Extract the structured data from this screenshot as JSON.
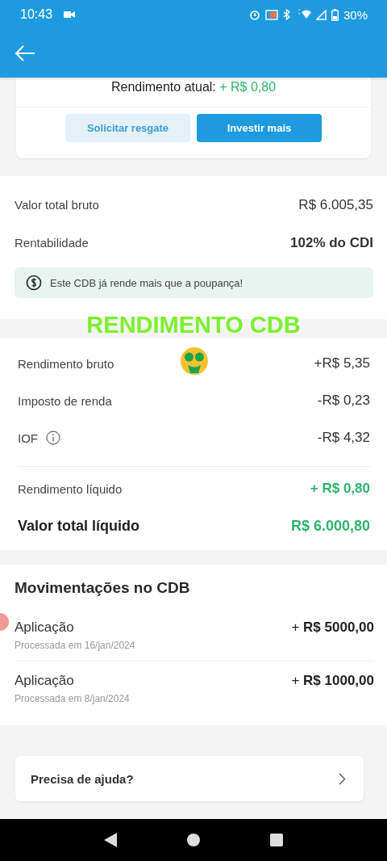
{
  "status_bar": {
    "time": "10:43",
    "battery": "30%"
  },
  "summary_card": {
    "current_yield_label": "Rendimento atual:",
    "current_yield_value": "+ R$ 0,80",
    "buttons": [
      {
        "label": "Solicitar resgate",
        "kind": "secondary"
      },
      {
        "label": "Investir mais",
        "kind": "primary"
      }
    ]
  },
  "totals": {
    "rows": [
      {
        "label": "Valor total bruto",
        "value": "R$ 6.005,35",
        "bold": false
      },
      {
        "label": "Rentabilidade",
        "value": "102% do CDI",
        "bold": true
      }
    ],
    "banner": "Este CDB já rende mais que a poupança!"
  },
  "overlay_caption": "RENDIMENTO CDB",
  "yield_breakdown": {
    "rows": [
      {
        "label": "Rendimento bruto",
        "value": "+R$ 5,35",
        "info": false
      },
      {
        "label": "Imposto de renda",
        "value": "-R$ 0,23",
        "info": false
      },
      {
        "label": "IOF",
        "value": "-R$ 4,32",
        "info": true
      }
    ],
    "net_yield": {
      "label": "Rendimento líquido",
      "value": "+ R$ 0,80"
    },
    "net_total": {
      "label": "Valor total líquido",
      "value": "R$ 6.000,80"
    }
  },
  "movements": {
    "title": "Movimentações no CDB",
    "items": [
      {
        "type": "Aplicação",
        "date": "Processada em 16/jan/2024",
        "sign": "+",
        "amount": "R$ 5000,00"
      },
      {
        "type": "Aplicação",
        "date": "Processada em 8/jan/2024",
        "sign": "+",
        "amount": "R$ 1000,00"
      }
    ]
  },
  "help": {
    "label": "Precisa de ajuda?"
  }
}
